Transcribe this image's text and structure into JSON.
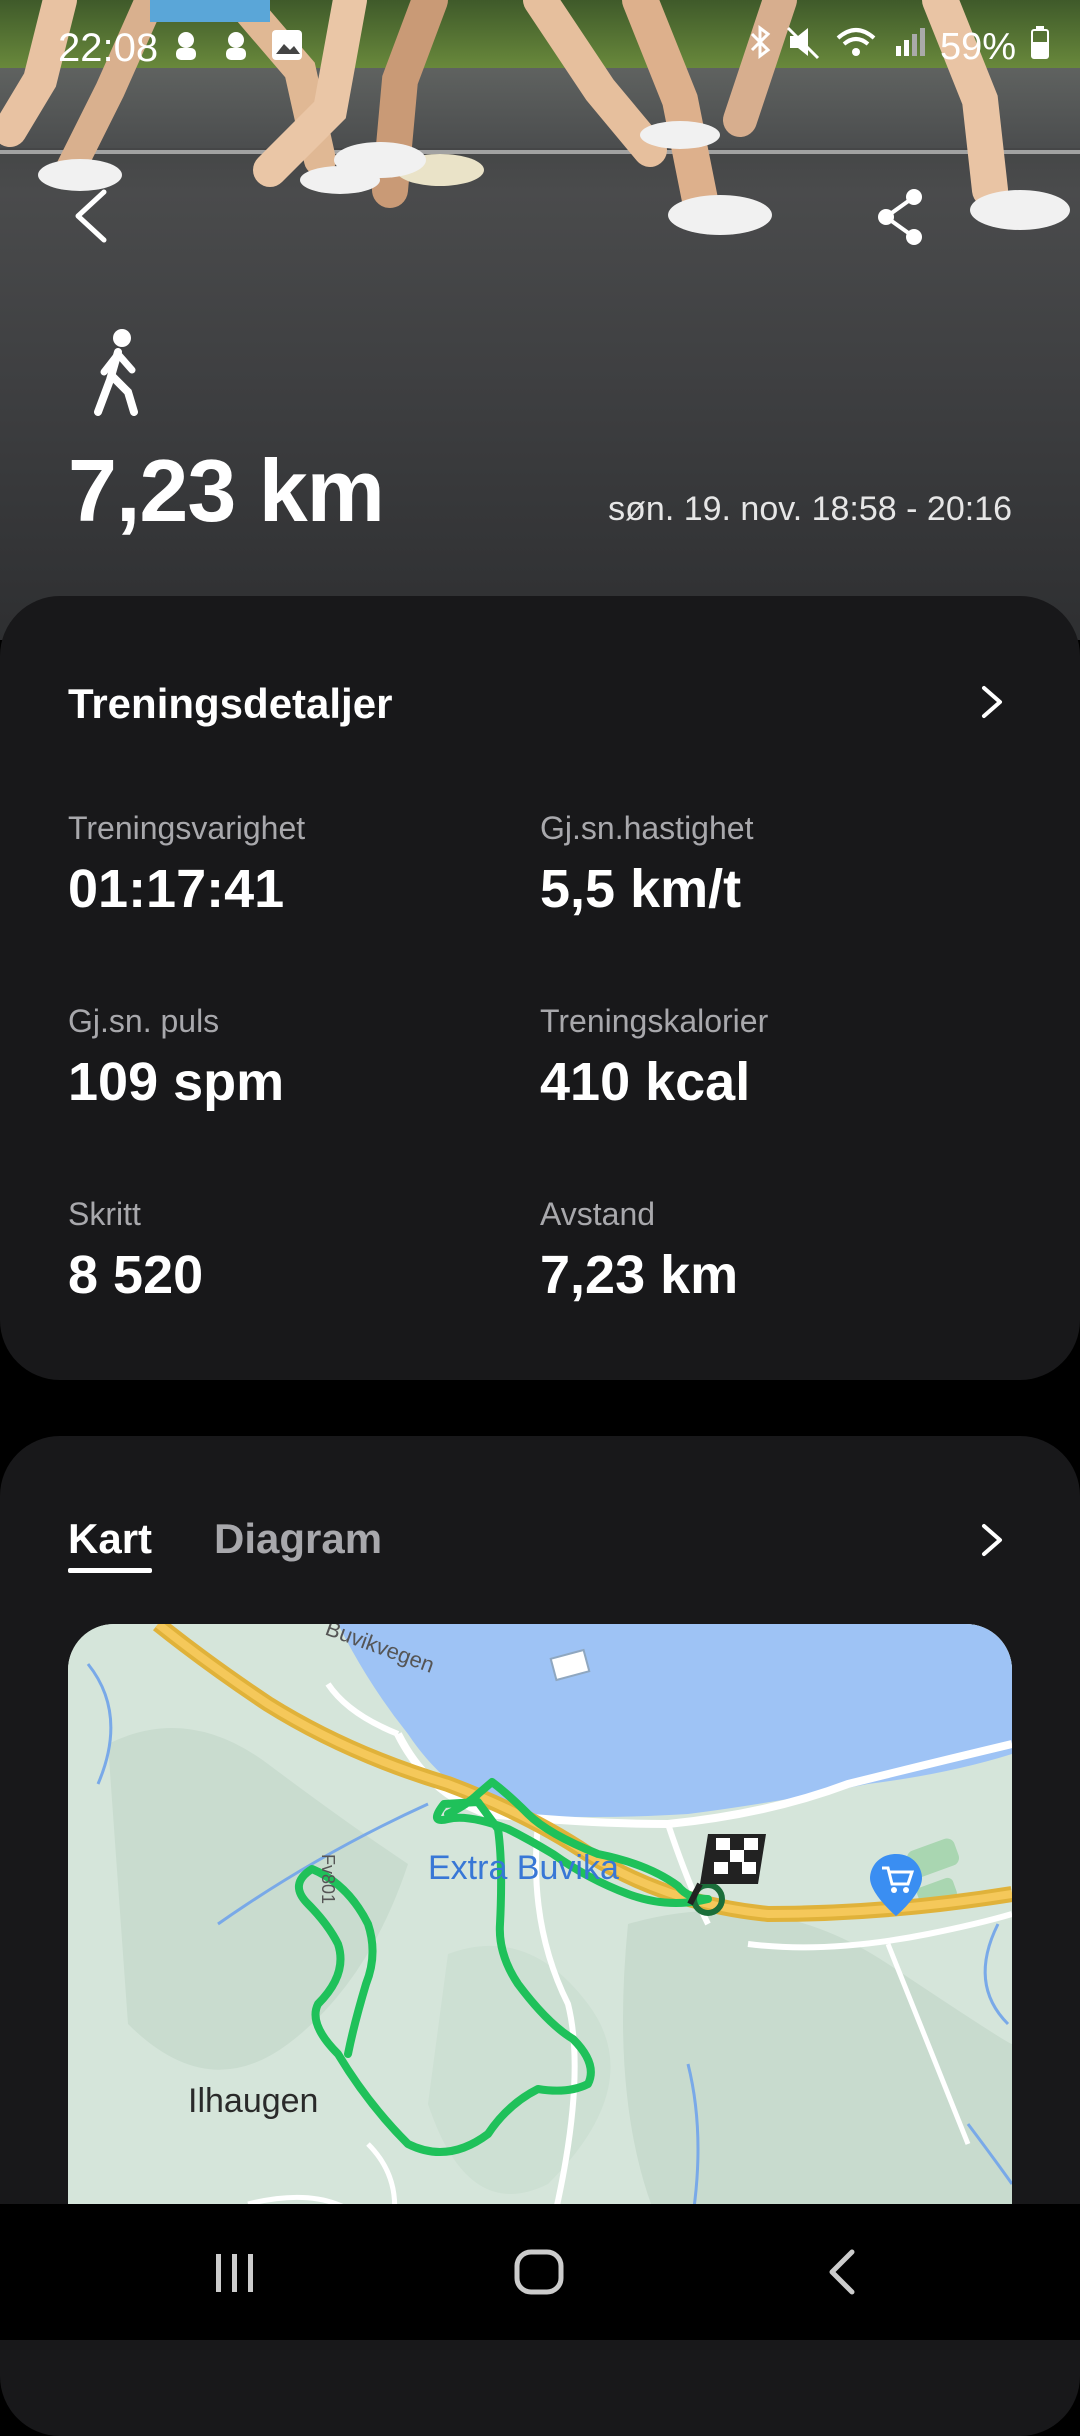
{
  "status_bar": {
    "time": "22:08",
    "battery": "59%"
  },
  "header": {
    "distance": "7,23 km",
    "date_range": "søn. 19. nov. 18:58 - 20:16",
    "activity_icon": "walking-person-icon"
  },
  "details": {
    "title": "Treningsdetaljer",
    "stats": [
      {
        "label": "Treningsvarighet",
        "value": "01:17:41"
      },
      {
        "label": "Gj.sn.hastighet",
        "value": "5,5 km/t"
      },
      {
        "label": "Gj.sn. puls",
        "value": "109 spm"
      },
      {
        "label": "Treningskalorier",
        "value": "410 kcal"
      },
      {
        "label": "Skritt",
        "value": "8 520"
      },
      {
        "label": "Avstand",
        "value": "7,23 km"
      }
    ]
  },
  "map_section": {
    "tabs": [
      {
        "label": "Kart",
        "active": true
      },
      {
        "label": "Diagram",
        "active": false
      }
    ],
    "labels": {
      "road": "Buvikvegen",
      "shop": "Extra Buvika",
      "place": "Ilhaugen",
      "route_code": "Fv801"
    },
    "route_color": "#1fc15a",
    "water_color": "#9ec3f5"
  }
}
